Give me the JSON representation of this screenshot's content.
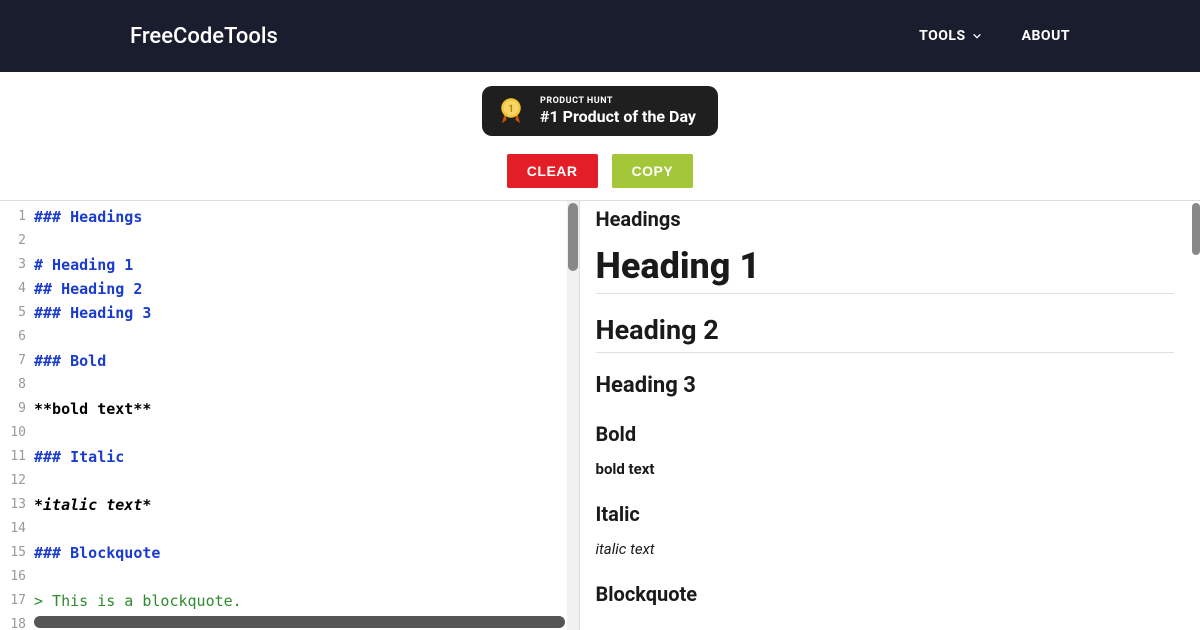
{
  "header": {
    "brand": "FreeCodeTools",
    "nav": {
      "tools": "TOOLS",
      "about": "ABOUT"
    }
  },
  "badge": {
    "label": "PRODUCT HUNT",
    "main": "#1 Product of the Day",
    "rank": "1"
  },
  "buttons": {
    "clear": "CLEAR",
    "copy": "COPY"
  },
  "editor": {
    "lines": [
      {
        "n": "1",
        "text": "### Headings",
        "cls": "c-header"
      },
      {
        "n": "2",
        "text": "",
        "cls": "c-plain"
      },
      {
        "n": "3",
        "text": "# Heading 1",
        "cls": "c-header"
      },
      {
        "n": "4",
        "text": "## Heading 2",
        "cls": "c-header"
      },
      {
        "n": "5",
        "text": "### Heading 3",
        "cls": "c-header"
      },
      {
        "n": "6",
        "text": "",
        "cls": "c-plain"
      },
      {
        "n": "7",
        "text": "### Bold",
        "cls": "c-header"
      },
      {
        "n": "8",
        "text": "",
        "cls": "c-plain"
      },
      {
        "n": "9",
        "text": "**bold text**",
        "cls": "c-plain"
      },
      {
        "n": "10",
        "text": "",
        "cls": "c-plain"
      },
      {
        "n": "11",
        "text": "### Italic",
        "cls": "c-header"
      },
      {
        "n": "12",
        "text": "",
        "cls": "c-plain"
      },
      {
        "n": "13",
        "text": "*italic text*",
        "cls": "c-italic"
      },
      {
        "n": "14",
        "text": "",
        "cls": "c-plain"
      },
      {
        "n": "15",
        "text": "### Blockquote",
        "cls": "c-header"
      },
      {
        "n": "16",
        "text": "",
        "cls": "c-plain"
      },
      {
        "n": "17",
        "text": "> This is a blockquote.",
        "cls": "c-quote"
      },
      {
        "n": "18",
        "text": "",
        "cls": "c-plain"
      }
    ]
  },
  "preview": {
    "sec_headings": "Headings",
    "h1": "Heading 1",
    "h2": "Heading 2",
    "h3": "Heading 3",
    "sec_bold": "Bold",
    "bold_text": "bold text",
    "sec_italic": "Italic",
    "italic_text": "italic text",
    "sec_blockquote": "Blockquote"
  }
}
